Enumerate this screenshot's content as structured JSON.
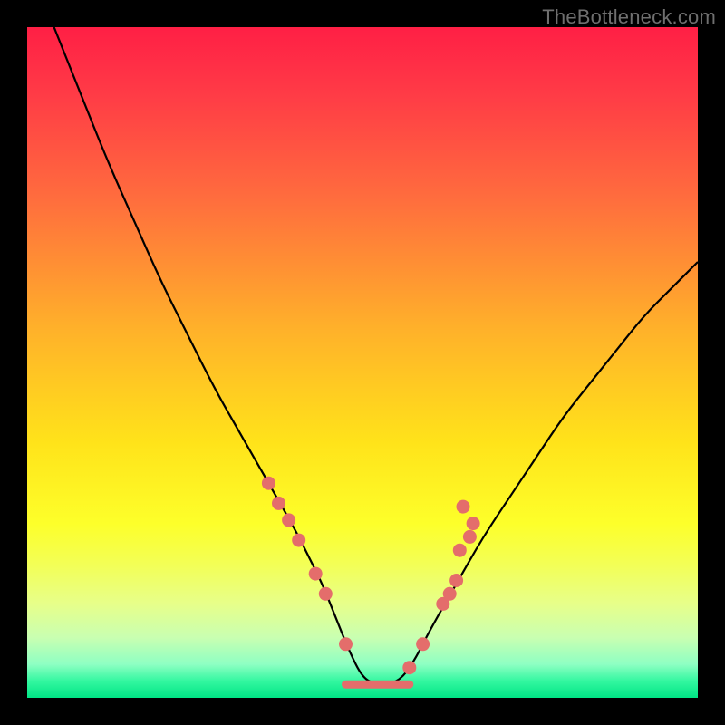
{
  "watermark": "TheBottleneck.com",
  "chart_data": {
    "type": "line",
    "title": "",
    "xlabel": "",
    "ylabel": "",
    "xlim": [
      0,
      100
    ],
    "ylim": [
      0,
      100
    ],
    "curve": {
      "name": "bottleneck-curve",
      "x": [
        4,
        8,
        12,
        16,
        20,
        24,
        28,
        32,
        36,
        40,
        42,
        44,
        46,
        48,
        50,
        52,
        54,
        56,
        58,
        60,
        64,
        68,
        72,
        76,
        80,
        84,
        88,
        92,
        96,
        100
      ],
      "y": [
        100,
        90,
        80,
        71,
        62,
        54,
        46,
        39,
        32,
        25,
        21,
        17,
        12,
        7,
        3,
        2,
        2,
        3,
        6,
        10,
        17,
        24,
        30,
        36,
        42,
        47,
        52,
        57,
        61,
        65
      ]
    },
    "dots": {
      "name": "sample-points",
      "color": "#e46d6b",
      "points": [
        {
          "x": 36.0,
          "y": 32.0
        },
        {
          "x": 37.5,
          "y": 29.0
        },
        {
          "x": 39.0,
          "y": 26.5
        },
        {
          "x": 40.5,
          "y": 23.5
        },
        {
          "x": 43.0,
          "y": 18.5
        },
        {
          "x": 44.5,
          "y": 15.5
        },
        {
          "x": 47.5,
          "y": 8.0
        },
        {
          "x": 57.0,
          "y": 4.5
        },
        {
          "x": 59.0,
          "y": 8.0
        },
        {
          "x": 62.0,
          "y": 14.0
        },
        {
          "x": 63.0,
          "y": 15.5
        },
        {
          "x": 64.0,
          "y": 17.5
        },
        {
          "x": 64.5,
          "y": 22.0
        },
        {
          "x": 66.0,
          "y": 24.0
        },
        {
          "x": 66.5,
          "y": 26.0
        },
        {
          "x": 65.0,
          "y": 28.5
        }
      ]
    },
    "flat_segment": {
      "name": "optimal-range",
      "color": "#e46d6b",
      "x0": 47.5,
      "x1": 57.0,
      "y": 2.0,
      "width": 9
    },
    "gradient_stops": [
      {
        "offset": 0.0,
        "color": "#ff1f45"
      },
      {
        "offset": 0.1,
        "color": "#ff3b46"
      },
      {
        "offset": 0.25,
        "color": "#ff6b3e"
      },
      {
        "offset": 0.45,
        "color": "#ffb12a"
      },
      {
        "offset": 0.62,
        "color": "#ffe31a"
      },
      {
        "offset": 0.74,
        "color": "#fdff2a"
      },
      {
        "offset": 0.8,
        "color": "#f3ff55"
      },
      {
        "offset": 0.86,
        "color": "#e7ff8a"
      },
      {
        "offset": 0.91,
        "color": "#c9ffb1"
      },
      {
        "offset": 0.95,
        "color": "#8effc3"
      },
      {
        "offset": 0.975,
        "color": "#33f7a0"
      },
      {
        "offset": 1.0,
        "color": "#00e585"
      }
    ]
  }
}
